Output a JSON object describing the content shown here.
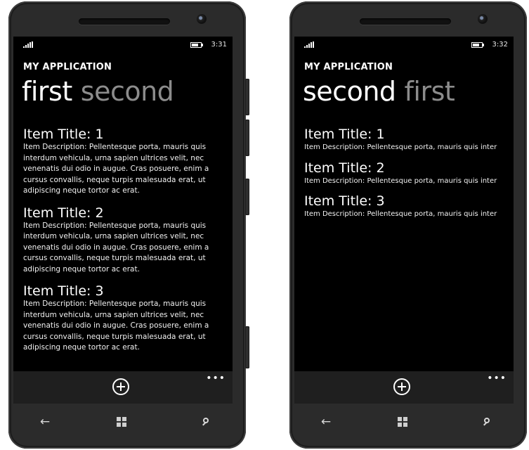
{
  "phones": [
    {
      "status": {
        "time": "3:31"
      },
      "app_title": "MY APPLICATION",
      "pivot": {
        "active": "first",
        "inactive": "second"
      },
      "items": [
        {
          "title": "Item Title: 1",
          "description": "Item Description: Pellentesque porta, mauris quis\ninterdum vehicula, urna sapien ultrices velit, nec\nvenenatis dui odio in augue. Cras posuere, enim a\ncursus convallis, neque turpis malesuada erat, ut\nadipiscing neque tortor ac erat."
        },
        {
          "title": "Item Title: 2",
          "description": "Item Description: Pellentesque porta, mauris quis\ninterdum vehicula, urna sapien ultrices velit, nec\nvenenatis dui odio in augue. Cras posuere, enim a\ncursus convallis, neque turpis malesuada erat, ut\nadipiscing neque tortor ac erat."
        },
        {
          "title": "Item Title: 3",
          "description": "Item Description: Pellentesque porta, mauris quis\ninterdum vehicula, urna sapien ultrices velit, nec\nvenenatis dui odio in augue. Cras posuere, enim a\ncursus convallis, neque turpis malesuada erat, ut\nadipiscing neque tortor ac erat."
        }
      ],
      "appbar": {
        "ellipsis": "•••",
        "add_icon": "add-circle-icon"
      },
      "nav": {
        "back_icon": "back-arrow-icon",
        "start_icon": "windows-logo-icon",
        "search_icon": "search-icon"
      }
    },
    {
      "status": {
        "time": "3:32"
      },
      "app_title": "MY APPLICATION",
      "pivot": {
        "active": "second",
        "inactive": "first"
      },
      "items": [
        {
          "title": "Item Title: 1",
          "description": "Item Description: Pellentesque porta, mauris quis inter"
        },
        {
          "title": "Item Title: 2",
          "description": "Item Description: Pellentesque porta, mauris quis inter"
        },
        {
          "title": "Item Title: 3",
          "description": "Item Description: Pellentesque porta, mauris quis inter"
        }
      ],
      "appbar": {
        "ellipsis": "•••",
        "add_icon": "add-circle-icon"
      },
      "nav": {
        "back_icon": "back-arrow-icon",
        "start_icon": "windows-logo-icon",
        "search_icon": "search-icon"
      }
    }
  ],
  "colors": {
    "screen_bg": "#000000",
    "phone_body": "#2b2b2b",
    "appbar_bg": "#1f1f1f",
    "inactive_pivot": "#8c8c8c"
  }
}
